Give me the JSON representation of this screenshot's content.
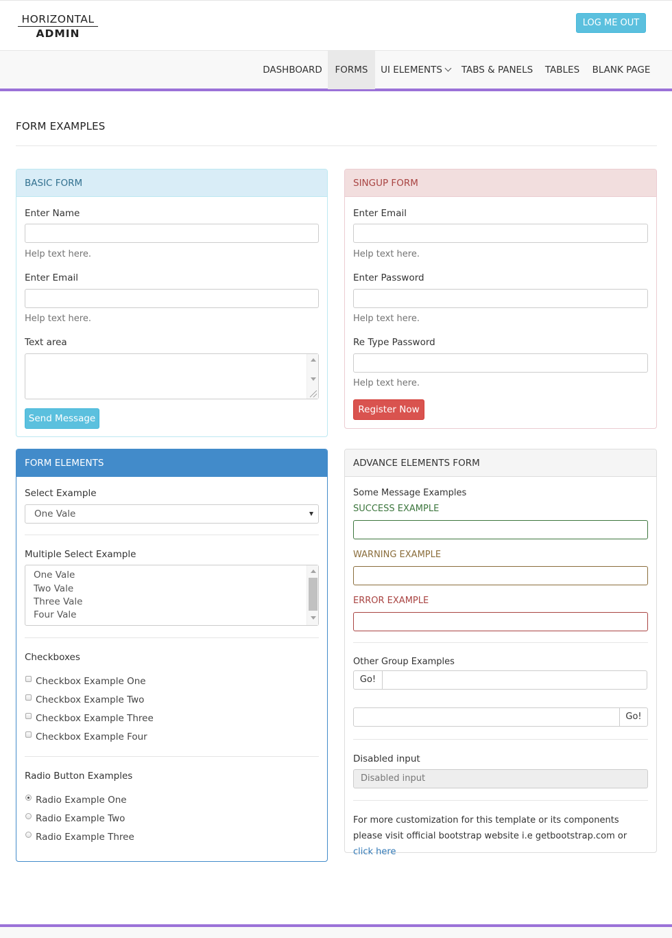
{
  "brand": {
    "line1": "HORIZONTAL",
    "line2": "ADMIN"
  },
  "header": {
    "logout_label": "LOG ME OUT"
  },
  "nav": {
    "items": [
      {
        "label": "DASHBOARD"
      },
      {
        "label": "FORMS",
        "active": true
      },
      {
        "label": "UI ELEMENTS",
        "has_dropdown": true
      },
      {
        "label": "TABS & PANELS"
      },
      {
        "label": "TABLES"
      },
      {
        "label": "BLANK PAGE"
      }
    ]
  },
  "page": {
    "title": "FORM EXAMPLES"
  },
  "basic_form": {
    "title": "BASIC FORM",
    "name_label": "Enter Name",
    "name_value": "",
    "help1": "Help text here.",
    "email_label": "Enter Email",
    "email_value": "",
    "help2": "Help text here.",
    "textarea_label": "Text area",
    "button": "Send Message"
  },
  "signup_form": {
    "title": "SINGUP FORM",
    "email_label": "Enter Email",
    "help1": "Help text here.",
    "password_label": "Enter Password",
    "help2": "Help text here.",
    "retype_label": "Re Type Password",
    "help3": "Help text here.",
    "button": "Register Now"
  },
  "form_elements": {
    "title": "FORM ELEMENTS",
    "select_label": "Select Example",
    "select_value": "One Vale",
    "multi_label": "Multiple Select Example",
    "multi_options": [
      "One Vale",
      "Two Vale",
      "Three Vale",
      "Four Vale"
    ],
    "checkbox_heading": "Checkboxes",
    "checkboxes": [
      {
        "label": "Checkbox Example One",
        "checked": false
      },
      {
        "label": "Checkbox Example Two",
        "checked": false
      },
      {
        "label": "Checkbox Example Three",
        "checked": false
      },
      {
        "label": "Checkbox Example Four",
        "checked": false
      }
    ],
    "radio_heading": "Radio Button Examples",
    "radios": [
      {
        "label": "Radio Example One",
        "checked": true
      },
      {
        "label": "Radio Example Two",
        "checked": false
      },
      {
        "label": "Radio Example Three",
        "checked": false
      }
    ]
  },
  "advance_form": {
    "title": "ADVANCE ELEMENTS FORM",
    "message_heading": "Some Message Examples",
    "success_label": "SUCCESS EXAMPLE",
    "warning_label": "WARNING EXAMPLE",
    "error_label": "ERROR EXAMPLE",
    "group_heading": "Other Group Examples",
    "go_left": "Go!",
    "go_right": "Go!",
    "disabled_label": "Disabled input",
    "disabled_value": "Disabled input",
    "note_text": "For more customization for this template or its components please visit official bootstrap website i.e getbootstrap.com or ",
    "note_link": "click here"
  },
  "colors": {
    "accent": "#9b72d8",
    "info": "#5bc0de",
    "danger": "#d9534f",
    "primary": "#428bca",
    "success": "#3c763d",
    "warning": "#8a6d3b",
    "error": "#a94442"
  },
  "icons": [
    "chevron-down-icon",
    "select-arrow-icon",
    "scroll-up-icon",
    "scroll-down-icon",
    "resize-grip-icon"
  ]
}
